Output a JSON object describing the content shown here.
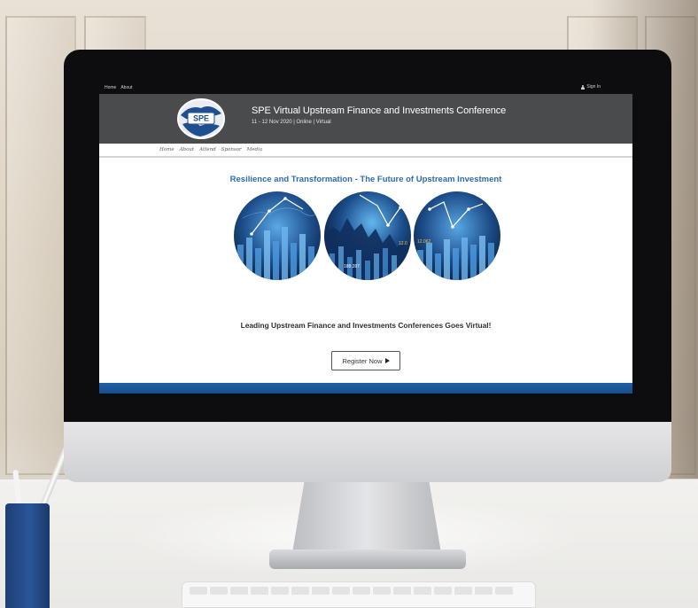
{
  "utility_nav": {
    "links": [
      "Home",
      "About"
    ],
    "sign_in": "Sign In"
  },
  "header": {
    "logo_text": "SPE",
    "title": "SPE Virtual Upstream Finance and Investments Conference",
    "subtitle": "11 - 12 Nov 2020 | Online | Virtual"
  },
  "nav": {
    "items": [
      "Home",
      "About",
      "Attend",
      "Sponsor",
      "Media"
    ]
  },
  "hero": {
    "title": "Resilience and Transformation - The Future of Upstream Investment",
    "tagline": "Leading Upstream Finance and Investments Conferences Goes Virtual!",
    "register_label": "Register Now",
    "globe_labels": [
      "12.062",
      "12.0",
      "188.397"
    ]
  },
  "colors": {
    "header_bg": "#4a4b4d",
    "accent_blue": "#2c6db4",
    "footer_blue": "#1f5fa8"
  }
}
